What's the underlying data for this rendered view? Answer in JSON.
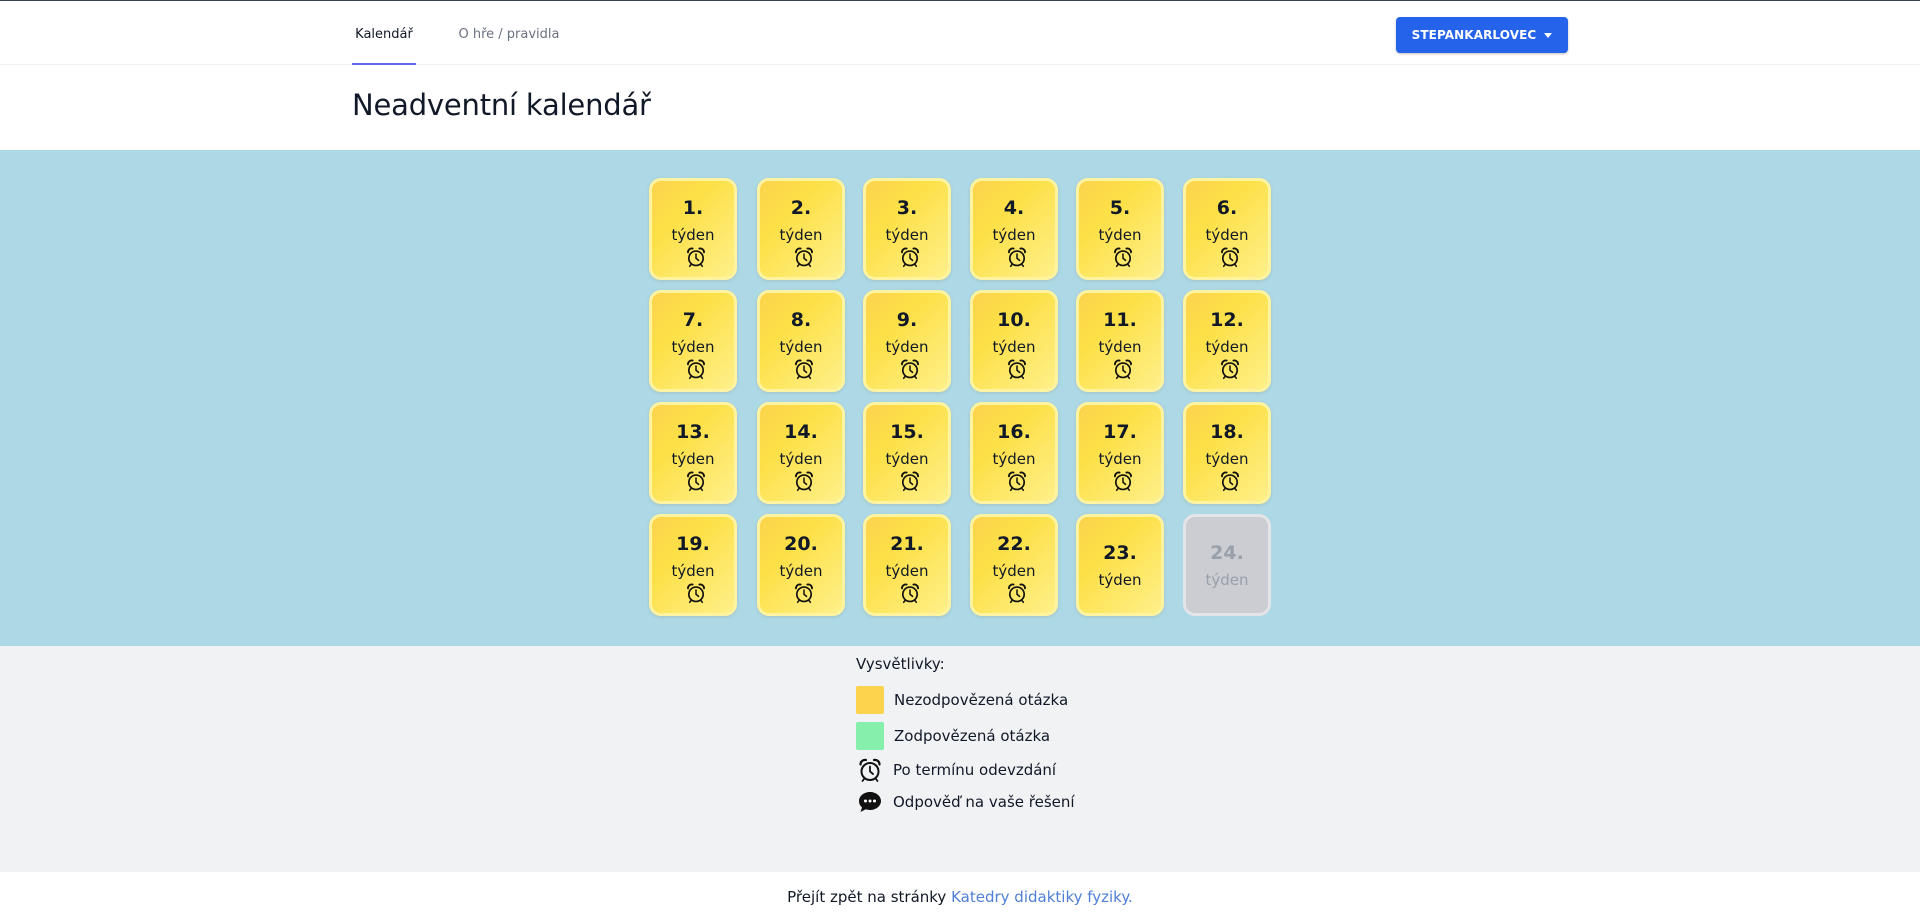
{
  "nav": {
    "tabs": [
      {
        "label": "Kalendář",
        "active": true
      },
      {
        "label": "O hře / pravidla",
        "active": false
      }
    ],
    "user_button": "STEPANKARLOVEC"
  },
  "page_title": "Neadventní kalendář",
  "tile_label": "týden",
  "weeks": [
    {
      "number": "1.",
      "state": "unanswered",
      "overdue": true
    },
    {
      "number": "2.",
      "state": "unanswered",
      "overdue": true
    },
    {
      "number": "3.",
      "state": "unanswered",
      "overdue": true
    },
    {
      "number": "4.",
      "state": "unanswered",
      "overdue": true
    },
    {
      "number": "5.",
      "state": "unanswered",
      "overdue": true
    },
    {
      "number": "6.",
      "state": "unanswered",
      "overdue": true
    },
    {
      "number": "7.",
      "state": "unanswered",
      "overdue": true
    },
    {
      "number": "8.",
      "state": "unanswered",
      "overdue": true
    },
    {
      "number": "9.",
      "state": "unanswered",
      "overdue": true
    },
    {
      "number": "10.",
      "state": "unanswered",
      "overdue": true
    },
    {
      "number": "11.",
      "state": "unanswered",
      "overdue": true
    },
    {
      "number": "12.",
      "state": "unanswered",
      "overdue": true
    },
    {
      "number": "13.",
      "state": "unanswered",
      "overdue": true
    },
    {
      "number": "14.",
      "state": "unanswered",
      "overdue": true
    },
    {
      "number": "15.",
      "state": "unanswered",
      "overdue": true
    },
    {
      "number": "16.",
      "state": "unanswered",
      "overdue": true
    },
    {
      "number": "17.",
      "state": "unanswered",
      "overdue": true
    },
    {
      "number": "18.",
      "state": "unanswered",
      "overdue": true
    },
    {
      "number": "19.",
      "state": "unanswered",
      "overdue": true
    },
    {
      "number": "20.",
      "state": "unanswered",
      "overdue": true
    },
    {
      "number": "21.",
      "state": "unanswered",
      "overdue": true
    },
    {
      "number": "22.",
      "state": "unanswered",
      "overdue": true
    },
    {
      "number": "23.",
      "state": "unanswered",
      "overdue": false
    },
    {
      "number": "24.",
      "state": "locked",
      "overdue": false
    }
  ],
  "legend": {
    "title": "Vysvětlivky:",
    "items": [
      {
        "type": "swatch",
        "color": "#fcd34d",
        "text": "Nezodpovězená otázka"
      },
      {
        "type": "swatch",
        "color": "#86efac",
        "text": "Zodpovězená otázka"
      },
      {
        "type": "icon",
        "icon": "alarm-clock-icon",
        "text": "Po termínu odevzdání"
      },
      {
        "type": "icon",
        "icon": "speech-bubble-icon",
        "text": "Odpověď na vaše řešení"
      }
    ]
  },
  "footer": {
    "text": "Přejít zpět na stránky",
    "link": "Katedry didaktiky fyziky."
  },
  "colors": {
    "accent": "#2563eb",
    "board": "#add8e6",
    "tile": "#fcd34d",
    "locked": "#cbcdd3",
    "link": "#4f7fd6"
  }
}
